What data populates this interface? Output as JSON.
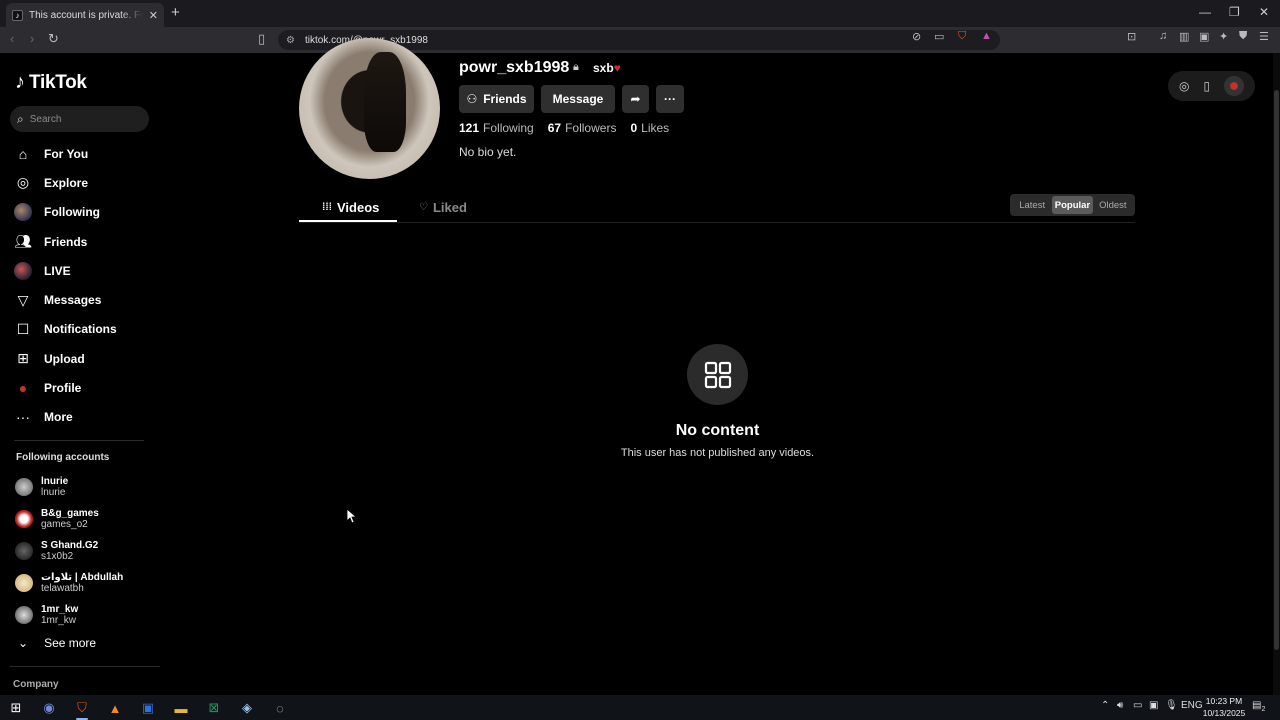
{
  "browser": {
    "tab_title": "This account is private. Follow th",
    "tab_close": "✕",
    "new_tab": "+",
    "url": "tiktok.com/@powr_sxb1998",
    "window_controls": [
      "—",
      "❐",
      "✕"
    ]
  },
  "brand": {
    "name": "TikTok"
  },
  "search": {
    "placeholder": "Search"
  },
  "nav": [
    {
      "label": "For You",
      "icon": "home-icon"
    },
    {
      "label": "Explore",
      "icon": "compass-icon"
    },
    {
      "label": "Following",
      "icon": "following-avatar-icon"
    },
    {
      "label": "Friends",
      "icon": "friends-icon"
    },
    {
      "label": "LIVE",
      "icon": "live-icon"
    },
    {
      "label": "Messages",
      "icon": "messages-icon"
    },
    {
      "label": "Notifications",
      "icon": "notifications-icon"
    },
    {
      "label": "Upload",
      "icon": "upload-icon"
    },
    {
      "label": "Profile",
      "icon": "profile-icon"
    },
    {
      "label": "More",
      "icon": "more-icon"
    }
  ],
  "following_accounts": {
    "title": "Following accounts",
    "items": [
      {
        "name": "lnurie",
        "user": "lnurie"
      },
      {
        "name": "B&g_games",
        "user": "games_o2"
      },
      {
        "name": "S Ghand.G2",
        "user": "s1x0b2"
      },
      {
        "name": "تلاوات | Abdullah",
        "user": "telawatbh"
      },
      {
        "name": "1mr_kw",
        "user": "1mr_kw"
      }
    ],
    "see_more": "See more"
  },
  "footer": {
    "company": "Company"
  },
  "profile": {
    "username": "powr_sxb1998",
    "nickname": "sxb",
    "friends_button": "Friends",
    "message_button": "Message",
    "following_count": "121",
    "following_label": "Following",
    "followers_count": "67",
    "followers_label": "Followers",
    "likes_count": "0",
    "likes_label": "Likes",
    "bio": "No bio yet."
  },
  "tabs": {
    "videos": "Videos",
    "liked": "Liked"
  },
  "sort": {
    "options": [
      "Latest",
      "Popular",
      "Oldest"
    ],
    "selected": "Popular"
  },
  "empty": {
    "title": "No content",
    "subtitle": "This user has not published any videos."
  },
  "taskbar": {
    "language": "ENG",
    "time": "10:23 PM",
    "date": "10/13/2025",
    "notification_count": "2"
  },
  "colors": {
    "accent": "#fe2c55",
    "background": "#000000",
    "heart": "#d3253a"
  }
}
